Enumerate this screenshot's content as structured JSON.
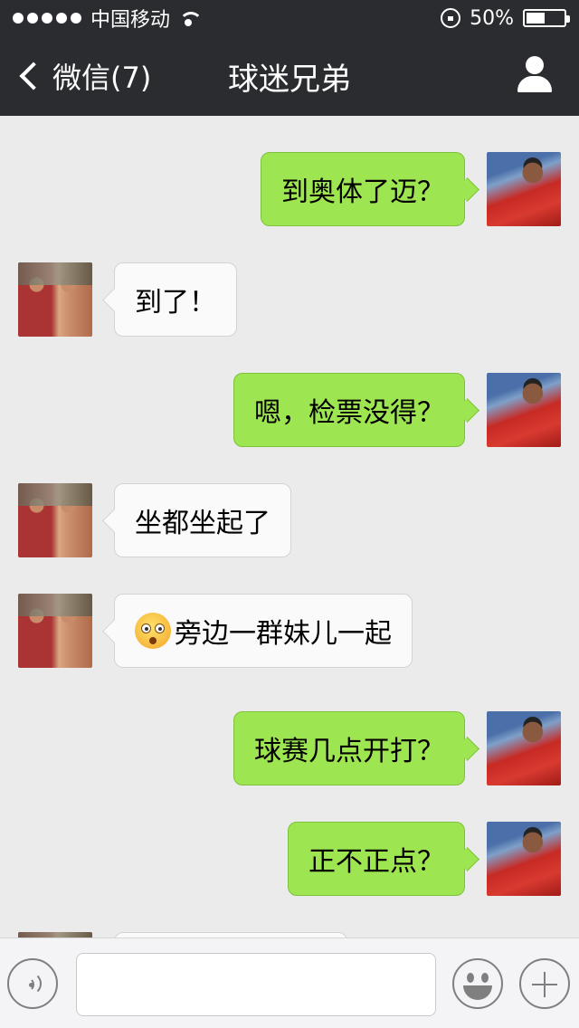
{
  "status_bar": {
    "carrier": "中国移动",
    "battery_text": "50%",
    "battery_level": 0.5
  },
  "nav": {
    "back_label": "微信(7)",
    "title": "球迷兄弟"
  },
  "messages": [
    {
      "from": "me",
      "text": "到奥体了迈？"
    },
    {
      "from": "other",
      "text": "到了！"
    },
    {
      "from": "me",
      "text": "嗯，检票没得？"
    },
    {
      "from": "other",
      "text": "坐都坐起了"
    },
    {
      "from": "other",
      "emoji": "surprised-face-icon",
      "text": "旁边一群妹儿一起"
    },
    {
      "from": "me",
      "text": "球赛几点开打？"
    },
    {
      "from": "me",
      "text": "正不正点？"
    }
  ],
  "input": {
    "placeholder": ""
  },
  "colors": {
    "header_bg": "#2b2c30",
    "chat_bg": "#ebebeb",
    "my_bubble": "#9ee552",
    "other_bubble": "#fafafa"
  }
}
